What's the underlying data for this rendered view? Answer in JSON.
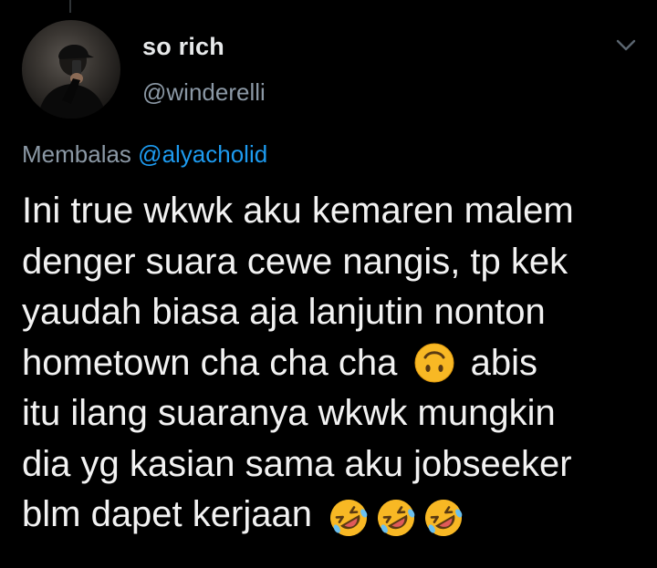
{
  "tweet": {
    "author": {
      "display_name": "so rich",
      "handle": "@winderelli"
    },
    "reply_prefix": "Membalas",
    "reply_mention": "@alyacholid",
    "text_lines": [
      "Ini true wkwk aku kemaren malem",
      "denger suara cewe nangis, tp kek",
      "yaudah biasa aja lanjutin nonton",
      "hometown cha cha cha",
      "abis",
      "itu ilang suaranya wkwk mungkin",
      "dia yg kasian sama aku jobseeker",
      "blm dapet kerjaan"
    ],
    "emojis": {
      "inline": "upside-down-face",
      "trailing": [
        "rolling-on-floor-laughing",
        "rolling-on-floor-laughing",
        "rolling-on-floor-laughing"
      ]
    },
    "icons": {
      "menu": "chevron-down-icon"
    },
    "colors": {
      "background": "#000000",
      "text": "#e7e9ea",
      "muted": "#8b98a5",
      "link": "#1d9bf0",
      "emoji_yellow": "#f8b824"
    }
  }
}
